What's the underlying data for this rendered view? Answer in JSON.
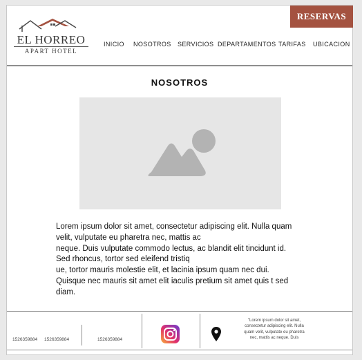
{
  "header": {
    "logo": {
      "title": "EL HORREO",
      "subtitle": "APART HOTEL",
      "roof_color": "#a45240"
    },
    "reservas_label": "RESERVAS",
    "nav": [
      "INICIO",
      "NOSOTROS",
      "SERVICIOS",
      "DEPARTAMENTOS",
      "TARIFAS",
      "UBICACION"
    ]
  },
  "main": {
    "title": "NOSOTROS",
    "image_icon": "image-placeholder-icon",
    "paragraph_lines": [
      "Lorem ipsum dolor sit amet, consectetur adipiscing elit. Nulla quam",
      "velit, vulputate eu pharetra nec, mattis ac",
      "neque. Duis vulputate commodo lectus, ac blandit elit tincidunt id.",
      "Sed rhoncus, tortor sed eleifend tristiq",
      "ue, tortor mauris molestie elit, et lacinia ipsum quam nec dui.",
      "Quisque nec mauris sit amet elit iaculis pretium sit amet quis t sed",
      "diam."
    ]
  },
  "footer": {
    "phones": [
      "1526359884",
      "1526359884",
      "1526359884"
    ],
    "instagram_icon": "instagram-icon",
    "location_icon": "location-pin-icon",
    "note_lines": [
      "\"Lorem ipsum dolor sit amet,",
      "consectetur adipiscing elit. Nulla",
      "quam velit, vulputate eu pharetra",
      "nec, mattis ac neque. Duis"
    ]
  },
  "colors": {
    "accent": "#a45240",
    "divider": "#8e8e8e",
    "placeholder": "#e6e6e6",
    "placeholder_icon": "#b3b3b3"
  }
}
